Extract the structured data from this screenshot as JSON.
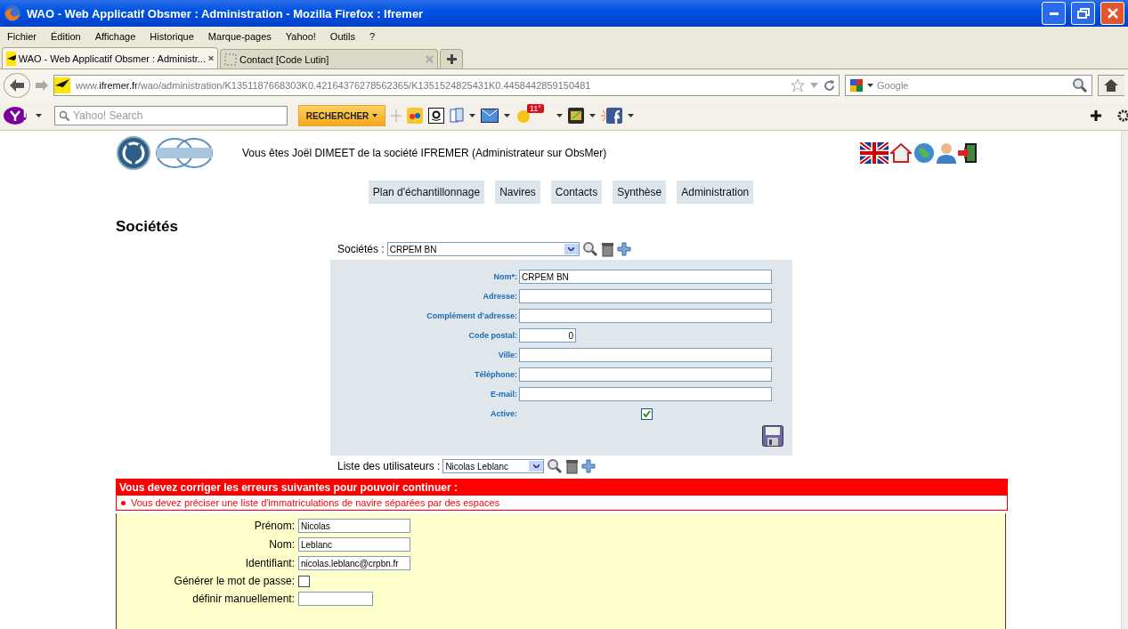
{
  "window": {
    "title": "WAO - Web Applicatif Obsmer : Administration - Mozilla Firefox : Ifremer"
  },
  "menu": [
    "Fichier",
    "Édition",
    "Affichage",
    "Historique",
    "Marque-pages",
    "Yahoo!",
    "Outils",
    "?"
  ],
  "tabs": [
    {
      "label": "WAO - Web Applicatif Obsmer : Administr...",
      "selected": true
    },
    {
      "label": "Contact [Code Lutin]",
      "selected": false
    }
  ],
  "address": {
    "domain_prefix": "www.",
    "domain": "ifremer.fr",
    "path": "/wao/administration/K1351187668303K0.42164376278562365/K1351524825431K0.4458442859150481"
  },
  "search": {
    "placeholder": "Google"
  },
  "yahoo_toolbar": {
    "search_placeholder": "Yahoo! Search",
    "search_button": "RECHERCHER",
    "weather": "11°"
  },
  "header": {
    "user_line": "Vous êtes Joël DIMEET de la société IFREMER (Administrateur sur ObsMer)"
  },
  "nav": [
    "Plan d'échantillonnage",
    "Navires",
    "Contacts",
    "Synthèse",
    "Administration"
  ],
  "page_title": "Sociétés",
  "company_select": {
    "label": "Sociétés :",
    "value": "CRPEM BN"
  },
  "company_form": [
    {
      "label": "Nom*:",
      "kind": "text",
      "value": "CRPEM BN"
    },
    {
      "label": "Adresse:",
      "kind": "text"
    },
    {
      "label": "Complément d'adresse:",
      "kind": "text"
    },
    {
      "label": "Code postal:",
      "kind": "short",
      "value": "0"
    },
    {
      "label": "Ville:",
      "kind": "text"
    },
    {
      "label": "Téléphone:",
      "kind": "text"
    },
    {
      "label": "E-mail:",
      "kind": "text"
    },
    {
      "label": "Active:",
      "kind": "checkbox",
      "checked": true
    }
  ],
  "user_select": {
    "label": "Liste des utilisateurs :",
    "value": "Nicolas Leblanc"
  },
  "errors": {
    "title": "Vous devez corriger les erreurs suivantes pour pouvoir continuer :",
    "items": [
      "Vous devez préciser une liste d'immatriculations de navire séparées par des espaces"
    ]
  },
  "user_form": [
    {
      "label": "Prénom:",
      "kind": "text",
      "value": "Nicolas"
    },
    {
      "label": "Nom:",
      "kind": "text",
      "value": "Leblanc"
    },
    {
      "label": "Identifiant:",
      "kind": "text",
      "value": "nicolas.leblanc@crpbn.fr"
    },
    {
      "label": "Générer le mot de passe:",
      "kind": "checkbox",
      "checked": false
    },
    {
      "label": "définir manuellement:",
      "kind": "short"
    }
  ]
}
